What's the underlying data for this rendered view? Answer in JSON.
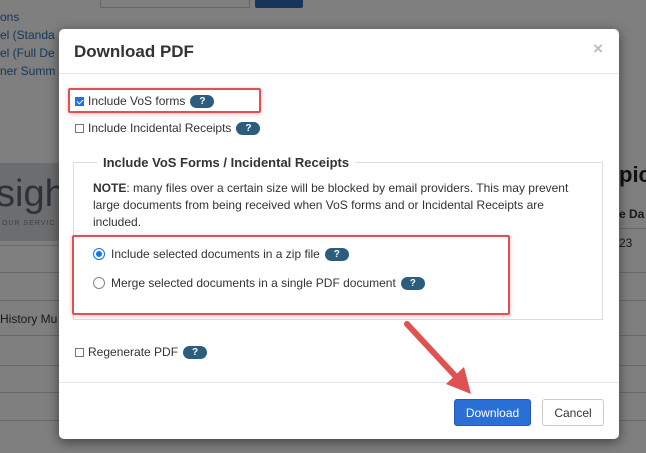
{
  "background": {
    "links": [
      "ons",
      "el (Standa",
      "el (Full De",
      "ner Summ"
    ],
    "logo_text": "sight",
    "logo_sub": "OUR  SERVIC",
    "history_text": "History Mu",
    "right_heading": "pic",
    "right_subheading": "e Da",
    "right_value": "23"
  },
  "modal": {
    "title": "Download PDF",
    "close_glyph": "×",
    "include_vos_forms": {
      "label": "Include VoS forms",
      "checked": true
    },
    "include_incidental_receipts": {
      "label": "Include Incidental Receipts",
      "checked": false
    },
    "fieldset": {
      "legend": "Include VoS Forms / Incidental Receipts",
      "note_label": "NOTE",
      "note_text": ": many files over a certain size will be blocked by email providers. This may prevent large documents from being received when VoS forms and or Incidental Receipts are included.",
      "options": [
        {
          "label": "Include selected documents in a zip file",
          "selected": true
        },
        {
          "label": "Merge selected documents in a single PDF document",
          "selected": false
        }
      ]
    },
    "regenerate_pdf": {
      "label": "Regenerate PDF",
      "checked": false
    },
    "help_glyph": "?",
    "download_label": "Download",
    "cancel_label": "Cancel"
  },
  "colors": {
    "primary": "#2a6fd6",
    "help_badge": "#2b5d7f",
    "highlight": "#e05252",
    "link": "#2a6db5"
  }
}
